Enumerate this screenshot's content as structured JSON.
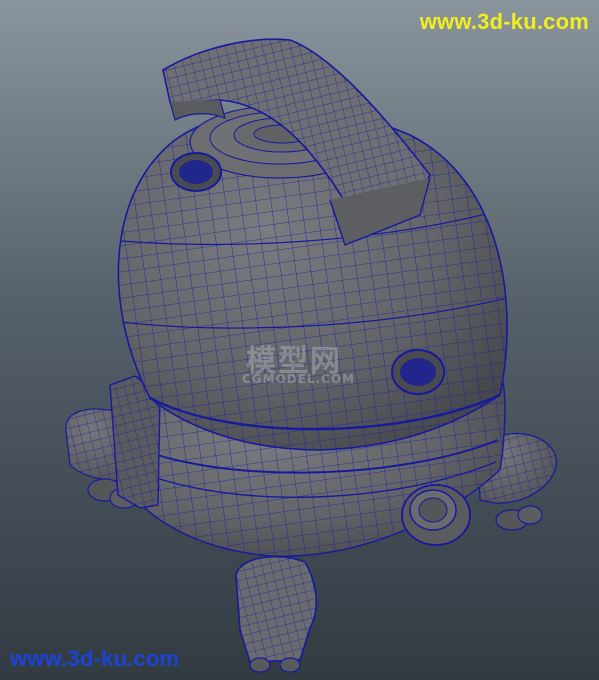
{
  "scene": {
    "object": "vacuum-cleaner wireframe model",
    "colors": {
      "bg_top": "#8a949c",
      "bg_bottom": "#323a42",
      "shade": "#65666a",
      "wire": "#151a9e",
      "hole": "#20268a"
    }
  },
  "watermarks": {
    "site_top": "www.3d-ku.com",
    "site_bottom": "www.3d-ku.com",
    "center_cn": "模型网",
    "center_en": "CGMODEL.COM"
  }
}
